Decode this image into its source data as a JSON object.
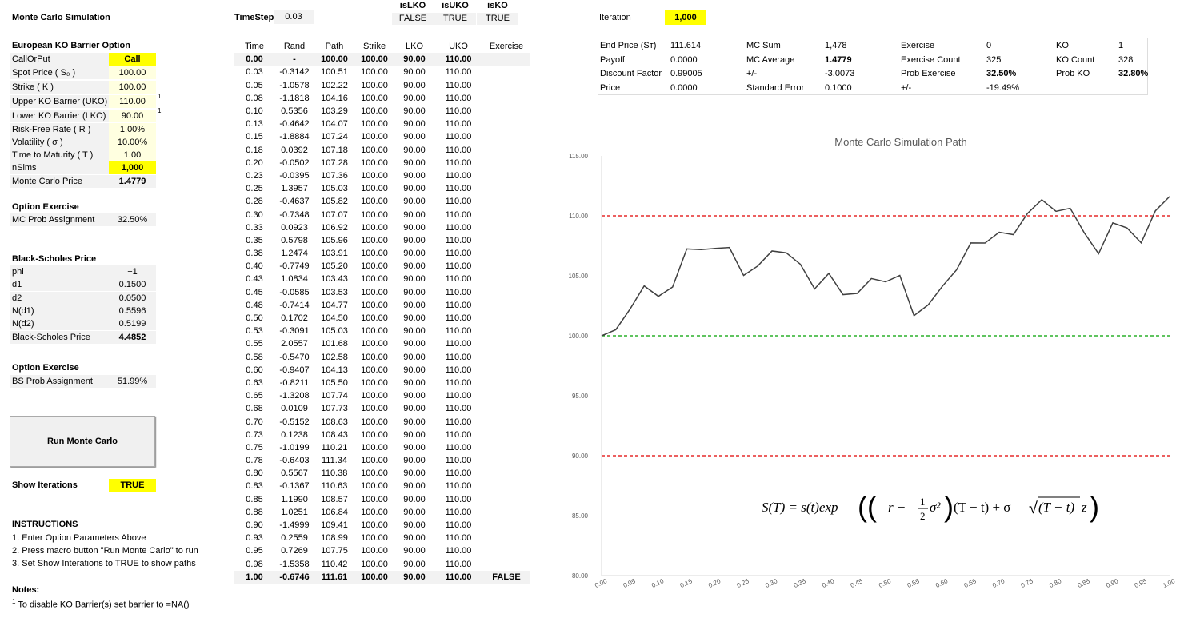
{
  "title": "Monte Carlo Simulation",
  "timestep": {
    "label": "TimeStep",
    "value": "0.03"
  },
  "flags": [
    {
      "label": "isLKO",
      "value": "FALSE"
    },
    {
      "label": "isUKO",
      "value": "TRUE"
    },
    {
      "label": "isKO",
      "value": "TRUE"
    }
  ],
  "iteration": {
    "label": "Iteration",
    "value": "1,000"
  },
  "option": {
    "heading": "European KO Barrier Option",
    "rows": [
      {
        "label": "CallOrPut",
        "value": "Call",
        "style": "yel b"
      },
      {
        "label": "Spot Price ( S₀ )",
        "value": "100.00",
        "style": "cream"
      },
      {
        "label": "Strike ( K )",
        "value": "100.00",
        "style": "cream"
      },
      {
        "label": "Upper KO Barrier (UKO)",
        "value": "110.00",
        "style": "cream",
        "note": "1"
      },
      {
        "label": "Lower KO Barrier (LKO)",
        "value": "90.00",
        "style": "cream",
        "note": "1"
      },
      {
        "label": "Risk-Free Rate ( R )",
        "value": "1.00%",
        "style": "cream"
      },
      {
        "label": "Volatility ( σ )",
        "value": "10.00%",
        "style": "cream"
      },
      {
        "label": "Time to Maturity ( T )",
        "value": "1.00",
        "style": "cream"
      },
      {
        "label": "nSims",
        "value": "1,000",
        "style": "yel b"
      },
      {
        "label": "Monte Carlo Price",
        "value": "1.4779",
        "style": "b"
      }
    ]
  },
  "mc_exercise": {
    "heading": "Option Exercise",
    "label": "MC Prob Assignment",
    "value": "32.50%"
  },
  "bs": {
    "heading": "Black-Scholes Price",
    "rows": [
      {
        "label": "phi",
        "value": "+1"
      },
      {
        "label": "d1",
        "value": "0.1500"
      },
      {
        "label": "d2",
        "value": "0.0500"
      },
      {
        "label": "N(d1)",
        "value": "0.5596"
      },
      {
        "label": "N(d2)",
        "value": "0.5199"
      },
      {
        "label": "Black-Scholes Price",
        "value": "4.4852",
        "bold": true
      }
    ]
  },
  "bs_exercise": {
    "heading": "Option Exercise",
    "label": "BS Prob Assignment",
    "value": "51.99%"
  },
  "run_button": "Run Monte Carlo",
  "show_iterations": {
    "label": "Show Iterations",
    "value": "TRUE"
  },
  "instructions": {
    "heading": "INSTRUCTIONS",
    "items": [
      "1. Enter Option Parameters Above",
      "2. Press macro button \"Run Monte Carlo\" to run",
      "3. Set Show Interations to TRUE to show paths"
    ]
  },
  "notes": {
    "heading": "Notes:",
    "sup": "1",
    "text": "To disable KO Barrier(s) set barrier to =NA()"
  },
  "table": {
    "headers": [
      "Time",
      "Rand",
      "Path",
      "Strike",
      "LKO",
      "UKO",
      "Exercise"
    ],
    "rows": [
      [
        "0.00",
        "-",
        "100.00",
        "100.00",
        "90.00",
        "110.00",
        ""
      ],
      [
        "0.03",
        "-0.3142",
        "100.51",
        "100.00",
        "90.00",
        "110.00",
        ""
      ],
      [
        "0.05",
        "-1.0578",
        "102.22",
        "100.00",
        "90.00",
        "110.00",
        ""
      ],
      [
        "0.08",
        "-1.1818",
        "104.16",
        "100.00",
        "90.00",
        "110.00",
        ""
      ],
      [
        "0.10",
        "0.5356",
        "103.29",
        "100.00",
        "90.00",
        "110.00",
        ""
      ],
      [
        "0.13",
        "-0.4642",
        "104.07",
        "100.00",
        "90.00",
        "110.00",
        ""
      ],
      [
        "0.15",
        "-1.8884",
        "107.24",
        "100.00",
        "90.00",
        "110.00",
        ""
      ],
      [
        "0.18",
        "0.0392",
        "107.18",
        "100.00",
        "90.00",
        "110.00",
        ""
      ],
      [
        "0.20",
        "-0.0502",
        "107.28",
        "100.00",
        "90.00",
        "110.00",
        ""
      ],
      [
        "0.23",
        "-0.0395",
        "107.36",
        "100.00",
        "90.00",
        "110.00",
        ""
      ],
      [
        "0.25",
        "1.3957",
        "105.03",
        "100.00",
        "90.00",
        "110.00",
        ""
      ],
      [
        "0.28",
        "-0.4637",
        "105.82",
        "100.00",
        "90.00",
        "110.00",
        ""
      ],
      [
        "0.30",
        "-0.7348",
        "107.07",
        "100.00",
        "90.00",
        "110.00",
        ""
      ],
      [
        "0.33",
        "0.0923",
        "106.92",
        "100.00",
        "90.00",
        "110.00",
        ""
      ],
      [
        "0.35",
        "0.5798",
        "105.96",
        "100.00",
        "90.00",
        "110.00",
        ""
      ],
      [
        "0.38",
        "1.2474",
        "103.91",
        "100.00",
        "90.00",
        "110.00",
        ""
      ],
      [
        "0.40",
        "-0.7749",
        "105.20",
        "100.00",
        "90.00",
        "110.00",
        ""
      ],
      [
        "0.43",
        "1.0834",
        "103.43",
        "100.00",
        "90.00",
        "110.00",
        ""
      ],
      [
        "0.45",
        "-0.0585",
        "103.53",
        "100.00",
        "90.00",
        "110.00",
        ""
      ],
      [
        "0.48",
        "-0.7414",
        "104.77",
        "100.00",
        "90.00",
        "110.00",
        ""
      ],
      [
        "0.50",
        "0.1702",
        "104.50",
        "100.00",
        "90.00",
        "110.00",
        ""
      ],
      [
        "0.53",
        "-0.3091",
        "105.03",
        "100.00",
        "90.00",
        "110.00",
        ""
      ],
      [
        "0.55",
        "2.0557",
        "101.68",
        "100.00",
        "90.00",
        "110.00",
        ""
      ],
      [
        "0.58",
        "-0.5470",
        "102.58",
        "100.00",
        "90.00",
        "110.00",
        ""
      ],
      [
        "0.60",
        "-0.9407",
        "104.13",
        "100.00",
        "90.00",
        "110.00",
        ""
      ],
      [
        "0.63",
        "-0.8211",
        "105.50",
        "100.00",
        "90.00",
        "110.00",
        ""
      ],
      [
        "0.65",
        "-1.3208",
        "107.74",
        "100.00",
        "90.00",
        "110.00",
        ""
      ],
      [
        "0.68",
        "0.0109",
        "107.73",
        "100.00",
        "90.00",
        "110.00",
        ""
      ],
      [
        "0.70",
        "-0.5152",
        "108.63",
        "100.00",
        "90.00",
        "110.00",
        ""
      ],
      [
        "0.73",
        "0.1238",
        "108.43",
        "100.00",
        "90.00",
        "110.00",
        ""
      ],
      [
        "0.75",
        "-1.0199",
        "110.21",
        "100.00",
        "90.00",
        "110.00",
        ""
      ],
      [
        "0.78",
        "-0.6403",
        "111.34",
        "100.00",
        "90.00",
        "110.00",
        ""
      ],
      [
        "0.80",
        "0.5567",
        "110.38",
        "100.00",
        "90.00",
        "110.00",
        ""
      ],
      [
        "0.83",
        "-0.1367",
        "110.63",
        "100.00",
        "90.00",
        "110.00",
        ""
      ],
      [
        "0.85",
        "1.1990",
        "108.57",
        "100.00",
        "90.00",
        "110.00",
        ""
      ],
      [
        "0.88",
        "1.0251",
        "106.84",
        "100.00",
        "90.00",
        "110.00",
        ""
      ],
      [
        "0.90",
        "-1.4999",
        "109.41",
        "100.00",
        "90.00",
        "110.00",
        ""
      ],
      [
        "0.93",
        "0.2559",
        "108.99",
        "100.00",
        "90.00",
        "110.00",
        ""
      ],
      [
        "0.95",
        "0.7269",
        "107.75",
        "100.00",
        "90.00",
        "110.00",
        ""
      ],
      [
        "0.98",
        "-1.5358",
        "110.42",
        "100.00",
        "90.00",
        "110.00",
        ""
      ],
      [
        "1.00",
        "-0.6746",
        "111.61",
        "100.00",
        "90.00",
        "110.00",
        "FALSE"
      ]
    ]
  },
  "stats": [
    {
      "label": "End Price (Sт)",
      "value": "111.614"
    },
    {
      "label": "Payoff",
      "value": "0.0000"
    },
    {
      "label": "Discount Factor",
      "value": "0.99005"
    },
    {
      "label": "Price",
      "value": "0.0000"
    },
    {
      "label": "MC Sum",
      "value": "1,478"
    },
    {
      "label": "MC Average",
      "value": "1.4779",
      "bold": true
    },
    {
      "label": "+/-",
      "value": "-3.0073"
    },
    {
      "label": "Standard Error",
      "value": "0.1000"
    },
    {
      "label": "Exercise",
      "value": "0"
    },
    {
      "label": "Exercise Count",
      "value": "325"
    },
    {
      "label": "Prob Exercise",
      "value": "32.50%",
      "bold": true
    },
    {
      "label": "+/-",
      "value": "-19.49%"
    },
    {
      "label": "KO",
      "value": "1"
    },
    {
      "label": "KO Count",
      "value": "328"
    },
    {
      "label": "Prob KO",
      "value": "32.80%",
      "bold": true
    }
  ],
  "chart_data": {
    "type": "line",
    "title": "Monte Carlo Simulation Path",
    "ylim": [
      80,
      115
    ],
    "yticks": [
      "80.00",
      "85.00",
      "90.00",
      "95.00",
      "100.00",
      "105.00",
      "110.00",
      "115.00"
    ],
    "xticks": [
      "0.00",
      "0.05",
      "0.10",
      "0.15",
      "0.20",
      "0.25",
      "0.30",
      "0.35",
      "0.40",
      "0.45",
      "0.50",
      "0.55",
      "0.60",
      "0.65",
      "0.70",
      "0.75",
      "0.80",
      "0.85",
      "0.90",
      "0.95",
      "1.00"
    ],
    "xlim": [
      0,
      1
    ],
    "series": [
      {
        "name": "Path",
        "color": "#404040"
      },
      {
        "name": "UKO",
        "value": 110,
        "color": "#e00000"
      },
      {
        "name": "Strike",
        "value": 100,
        "color": "#00a000"
      },
      {
        "name": "LKO",
        "value": 90,
        "color": "#e00000"
      }
    ],
    "path_values": [
      100.0,
      100.51,
      102.22,
      104.16,
      103.29,
      104.07,
      107.24,
      107.18,
      107.28,
      107.36,
      105.03,
      105.82,
      107.07,
      106.92,
      105.96,
      103.91,
      105.2,
      103.43,
      103.53,
      104.77,
      104.5,
      105.03,
      101.68,
      102.58,
      104.13,
      105.5,
      107.74,
      107.73,
      108.63,
      108.43,
      110.21,
      111.34,
      110.38,
      110.63,
      108.57,
      106.84,
      109.41,
      108.99,
      107.75,
      110.42,
      111.61
    ],
    "formula": {
      "lhs": "S(T) = s(t)exp",
      "half_num": "1",
      "half_den": "2",
      "text1": "r −",
      "sigma2": "σ²",
      "text2": "(T − t) + σ",
      "sqrt": "(T − t)",
      "z": "z"
    }
  }
}
